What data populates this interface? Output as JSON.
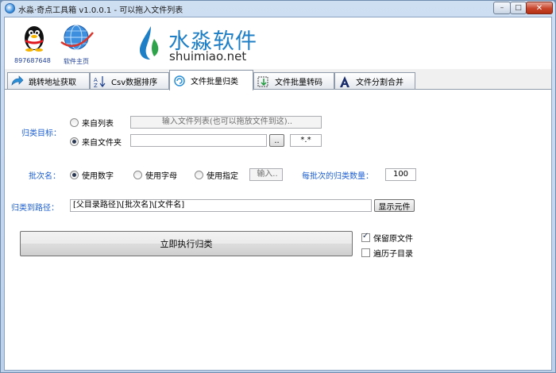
{
  "window": {
    "title": "水淼·奇点工具箱 v1.0.0.1 - 可以拖入文件列表",
    "min_glyph": "–",
    "max_glyph": "□",
    "close_glyph": "✕"
  },
  "header": {
    "qq_number": "897687648",
    "homepage_label": "软件主页",
    "logo_cn": "水淼软件",
    "logo_en": "shuimiao.net"
  },
  "tabs": [
    {
      "label": "跳转地址获取",
      "icon": "redirect-arrow-icon",
      "active": false
    },
    {
      "label": "Csv数据排序",
      "icon": "sort-az-icon",
      "active": false
    },
    {
      "label": "文件批量归类",
      "icon": "classify-icon",
      "active": true
    },
    {
      "label": "文件批量转码",
      "icon": "transcode-icon",
      "active": false
    },
    {
      "label": "文件分割合并",
      "icon": "split-merge-icon",
      "active": false
    }
  ],
  "form": {
    "target_label": "归类目标：",
    "source_list_label": "来自列表",
    "source_list_selected": false,
    "source_list_placeholder": "输入文件列表(也可以拖放文件到这)..",
    "source_folder_label": "来自文件夹",
    "source_folder_selected": true,
    "folder_path": "",
    "browse_button": "..",
    "filter_value": "*.*",
    "batch_name_label": "批次名：",
    "batch_options": [
      {
        "label": "使用数字",
        "selected": true
      },
      {
        "label": "使用字母",
        "selected": false
      },
      {
        "label": "使用指定",
        "selected": false
      }
    ],
    "batch_custom_placeholder": "输入..",
    "batch_count_label": "每批次的归类数量：",
    "batch_count_value": "100",
    "dest_path_label": "归类到路径：",
    "dest_path_value": "[父目录路径]\\[批次名]\\[文件名]",
    "show_elements_button": "显示元件",
    "run_button": "立即执行归类",
    "keep_original_label": "保留原文件",
    "keep_original_checked": true,
    "recurse_label": "遍历子目录",
    "recurse_checked": false
  },
  "colors": {
    "accent_blue": "#1d5fd1",
    "logo_blue": "#1e7fc6",
    "titlebar": "#c9dbf0",
    "close_red": "#c7442a"
  }
}
